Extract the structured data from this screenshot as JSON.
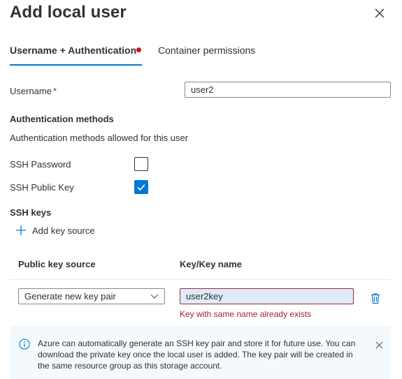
{
  "panel": {
    "title": "Add local user",
    "close_icon": "close-icon"
  },
  "tabs": [
    {
      "label": "Username + Authentication",
      "active": true,
      "has_error_dot": true
    },
    {
      "label": "Container permissions",
      "active": false
    }
  ],
  "username": {
    "label": "Username",
    "required_marker": "*",
    "value": "user2"
  },
  "auth_methods": {
    "heading": "Authentication methods",
    "description": "Authentication methods allowed for this user",
    "ssh_password": {
      "label": "SSH Password",
      "checked": false
    },
    "ssh_public_key": {
      "label": "SSH Public Key",
      "checked": true
    }
  },
  "ssh_keys": {
    "heading": "SSH keys",
    "add_label": "Add key source",
    "columns": [
      "Public key source",
      "Key/Key name"
    ],
    "rows": [
      {
        "source": "Generate new key pair",
        "key_name": "user2key",
        "error": "Key with same name already exists"
      }
    ]
  },
  "info": {
    "message": "Azure can automatically generate an SSH key pair and store it for future use. You can download the private key once the local user is added. The key pair will be created in the same resource group as this storage account."
  },
  "colors": {
    "accent": "#0078d4",
    "error": "#a4262c",
    "error_dot": "#e00b1c",
    "info_bg": "#f3f9fd"
  }
}
